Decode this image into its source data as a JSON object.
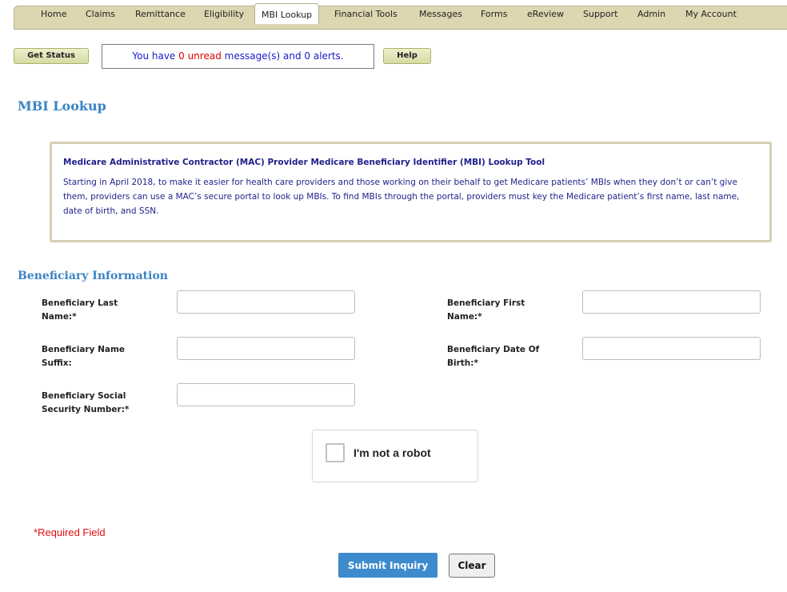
{
  "nav": {
    "items": [
      {
        "label": "Home"
      },
      {
        "label": "Claims"
      },
      {
        "label": "Remittance"
      },
      {
        "label": "Eligibility"
      },
      {
        "label": "MBI Lookup",
        "active": true
      },
      {
        "label": "Financial Tools"
      },
      {
        "label": "Messages"
      },
      {
        "label": "Forms"
      },
      {
        "label": "eReview"
      },
      {
        "label": "Support"
      },
      {
        "label": "Admin"
      },
      {
        "label": "My Account"
      }
    ]
  },
  "toolbar": {
    "get_status_label": "Get Status",
    "help_label": "Help",
    "message": {
      "prefix": "You have ",
      "unread_count": "0",
      "unread_word": " unread",
      "suffix": " message(s) and 0 alerts."
    }
  },
  "page": {
    "title": "MBI Lookup"
  },
  "info_box": {
    "heading": "Medicare Administrative Contractor (MAC) Provider Medicare Beneficiary Identifier (MBI) Lookup Tool",
    "body": "Starting in April 2018, to make it easier for health care providers and those working on their behalf to get Medicare patients’ MBIs when they don’t or can’t give them, providers can use a MAC’s secure portal to look up MBIs. To find MBIs through the portal, providers must key the Medicare patient’s first name, last name, date of birth, and SSN."
  },
  "form": {
    "section_title": "Beneficiary Information",
    "fields": {
      "last_name": {
        "label": "Beneficiary Last Name:*",
        "value": ""
      },
      "first_name": {
        "label": "Beneficiary First Name:*",
        "value": ""
      },
      "suffix": {
        "label": "Beneficiary Name Suffix:",
        "value": ""
      },
      "dob": {
        "label": "Beneficiary Date Of Birth:*",
        "value": ""
      },
      "ssn": {
        "label": "Beneficiary Social Security Number:*",
        "value": ""
      }
    },
    "captcha_label": "I'm not a robot",
    "required_note": "*Required Field",
    "submit_label": "Submit Inquiry",
    "clear_label": "Clear"
  },
  "colors": {
    "accent_blue": "#3b84c4",
    "nav_bg": "#dcd6b1",
    "required_red": "#e01010",
    "submit_bg": "#3d8bcd",
    "info_text": "#1f1f8a"
  }
}
